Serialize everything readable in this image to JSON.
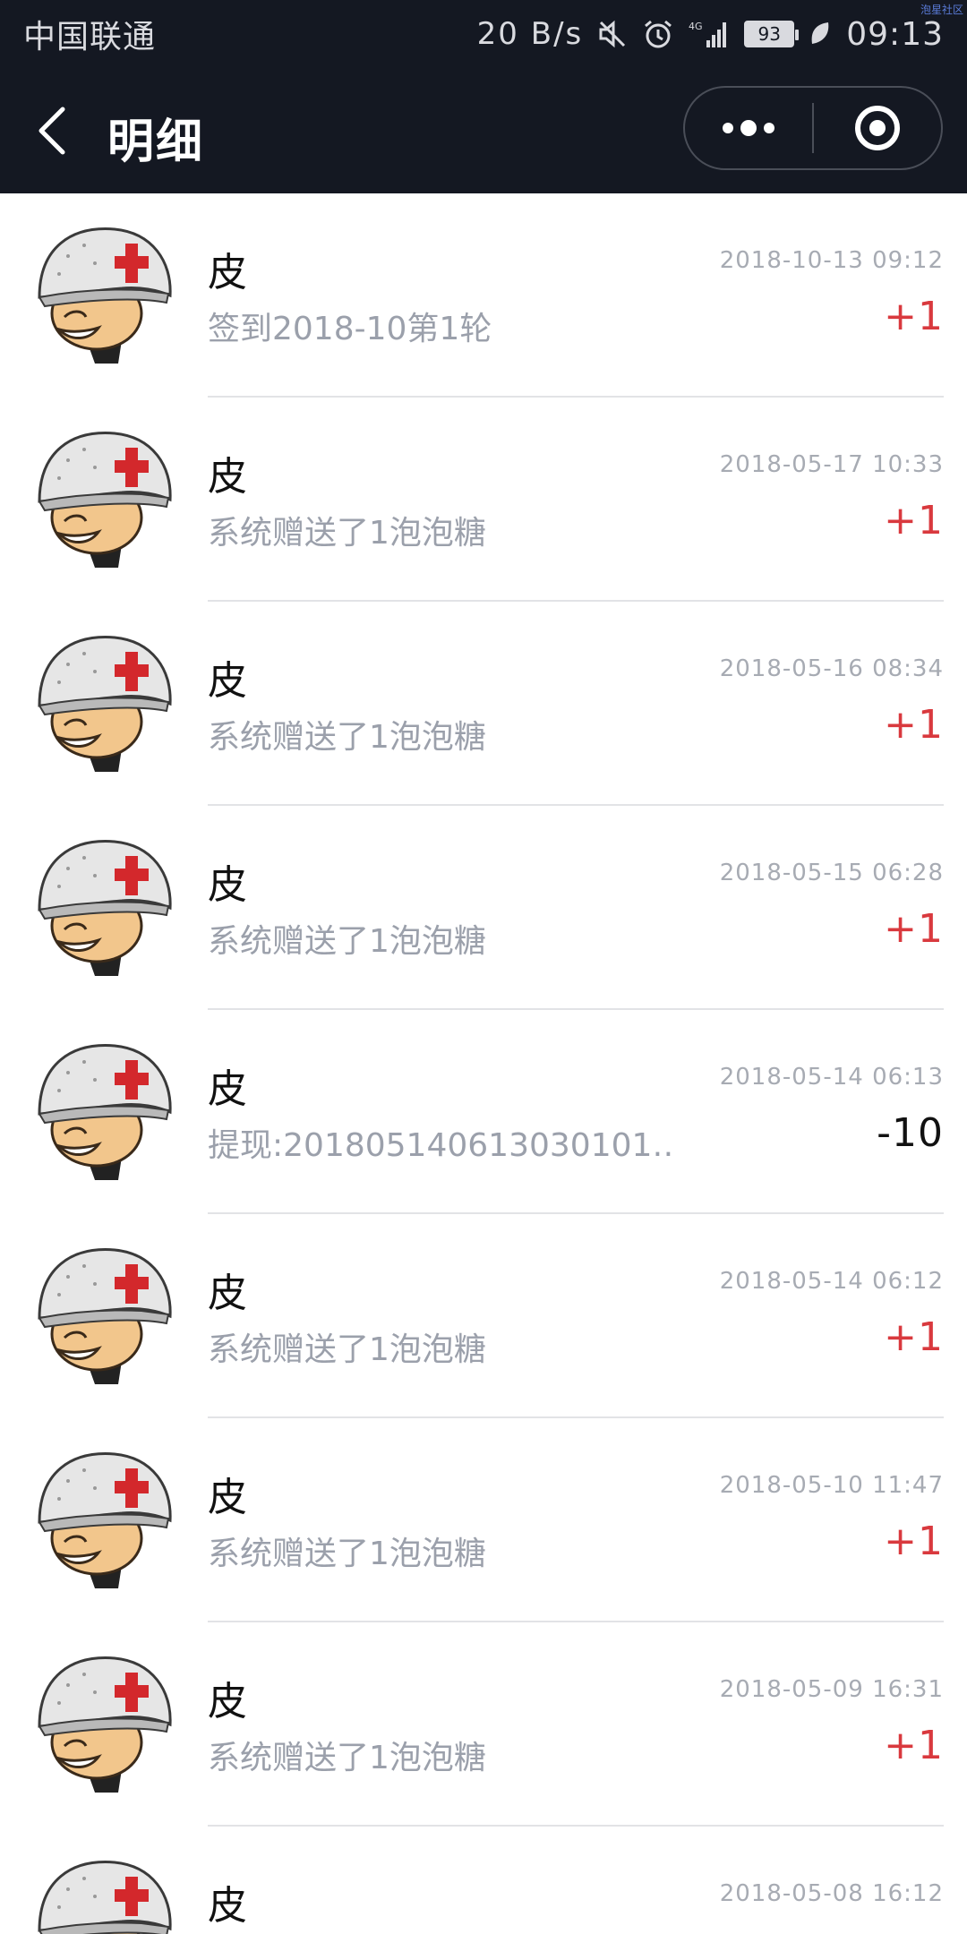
{
  "status_bar": {
    "carrier": "中国联通",
    "net_speed": "20 B/s",
    "signal": "4G",
    "battery": "93",
    "time": "09:13",
    "watermark": "泡星社区"
  },
  "nav": {
    "title": "明细",
    "back_icon": "chevron-left-icon",
    "more_icon": "more-dots-icon",
    "close_icon": "target-icon"
  },
  "colors": {
    "header_bg": "#141822",
    "positive": "#d9393e",
    "muted": "#9ba0ab"
  },
  "records": [
    {
      "name": "皮",
      "desc": "签到2018-10第1轮",
      "date": "2018-10-13 09:12",
      "amount": "+1",
      "sign": "pos"
    },
    {
      "name": "皮",
      "desc": "系统赠送了1泡泡糖",
      "date": "2018-05-17 10:33",
      "amount": "+1",
      "sign": "pos"
    },
    {
      "name": "皮",
      "desc": "系统赠送了1泡泡糖",
      "date": "2018-05-16 08:34",
      "amount": "+1",
      "sign": "pos"
    },
    {
      "name": "皮",
      "desc": "系统赠送了1泡泡糖",
      "date": "2018-05-15 06:28",
      "amount": "+1",
      "sign": "pos"
    },
    {
      "name": "皮",
      "desc": "提现:201805140613030101…",
      "date": "2018-05-14 06:13",
      "amount": "-10",
      "sign": "neg"
    },
    {
      "name": "皮",
      "desc": "系统赠送了1泡泡糖",
      "date": "2018-05-14 06:12",
      "amount": "+1",
      "sign": "pos"
    },
    {
      "name": "皮",
      "desc": "系统赠送了1泡泡糖",
      "date": "2018-05-10 11:47",
      "amount": "+1",
      "sign": "pos"
    },
    {
      "name": "皮",
      "desc": "系统赠送了1泡泡糖",
      "date": "2018-05-09 16:31",
      "amount": "+1",
      "sign": "pos"
    },
    {
      "name": "皮",
      "desc": "",
      "date": "2018-05-08 16:12",
      "amount": "",
      "sign": "pos"
    }
  ]
}
